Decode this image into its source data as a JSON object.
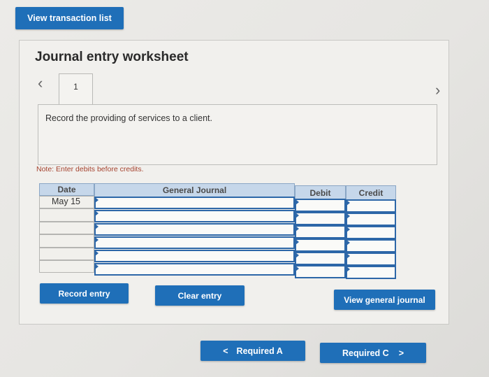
{
  "top": {
    "view_transaction_list": "View transaction list"
  },
  "worksheet": {
    "title": "Journal entry worksheet",
    "prev_icon": "chevron-left-icon",
    "next_icon": "chevron-right-icon",
    "active_tab": "1",
    "description": "Record the providing of services to a client.",
    "note": "Note: Enter debits before credits."
  },
  "table": {
    "headers": {
      "date": "Date",
      "journal": "General Journal",
      "debit": "Debit",
      "credit": "Credit"
    },
    "rows": [
      {
        "date": "May 15",
        "account": "",
        "debit": "",
        "credit": ""
      },
      {
        "date": "",
        "account": "",
        "debit": "",
        "credit": ""
      },
      {
        "date": "",
        "account": "",
        "debit": "",
        "credit": ""
      },
      {
        "date": "",
        "account": "",
        "debit": "",
        "credit": ""
      },
      {
        "date": "",
        "account": "",
        "debit": "",
        "credit": ""
      },
      {
        "date": "",
        "account": "",
        "debit": "",
        "credit": ""
      }
    ]
  },
  "actions": {
    "record_entry": "Record entry",
    "clear_entry": "Clear entry",
    "view_general_journal": "View general journal"
  },
  "navigation": {
    "prev_label": "Required A",
    "next_label": "Required C",
    "prev_glyph": "<",
    "next_glyph": ">"
  },
  "colors": {
    "button_blue": "#1f6fb8",
    "header_blue": "#c6d7ea",
    "note_red": "#a5422e"
  }
}
